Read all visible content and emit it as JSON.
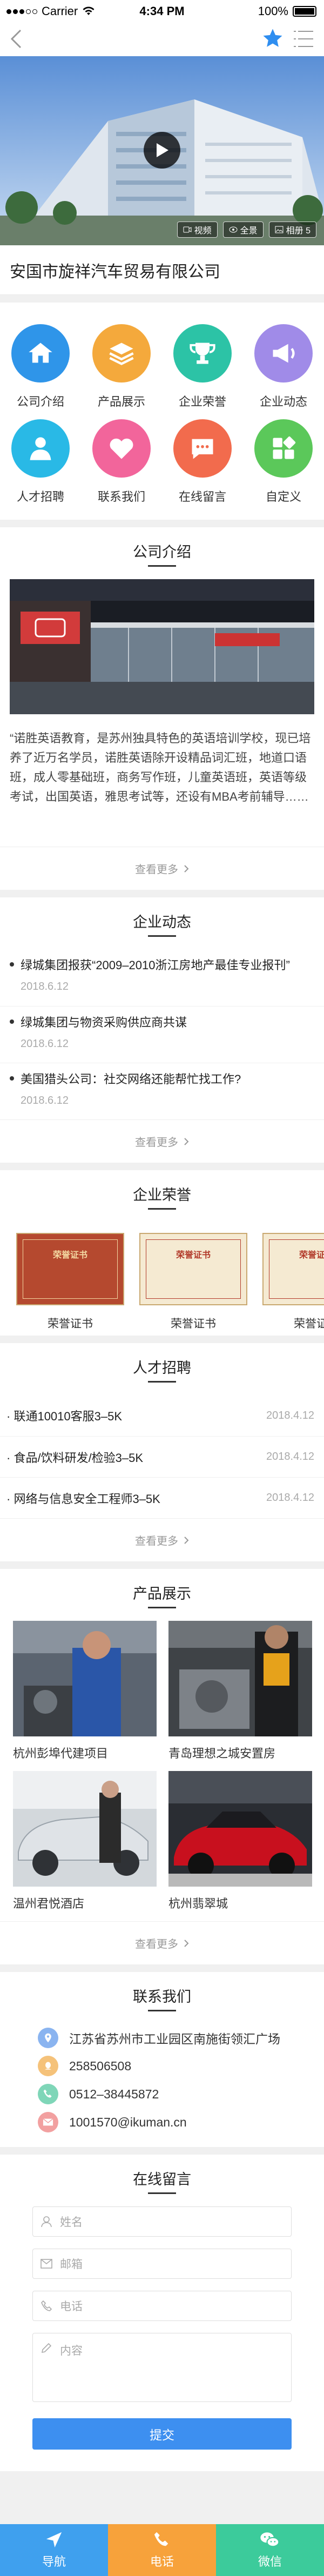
{
  "status": {
    "carrier": "Carrier",
    "time": "4:34 PM",
    "battery": "100%"
  },
  "hero": {
    "tags": [
      "视频",
      "全景",
      "相册 5"
    ]
  },
  "company": {
    "name": "安国市旋祥汽车贸易有限公司"
  },
  "grid": [
    {
      "label": "公司介绍",
      "icon": "home-icon",
      "color": "#2f95e9"
    },
    {
      "label": "产品展示",
      "icon": "layers-icon",
      "color": "#f4a93c"
    },
    {
      "label": "企业荣誉",
      "icon": "trophy-icon",
      "color": "#2cc3a6"
    },
    {
      "label": "企业动态",
      "icon": "megaphone-icon",
      "color": "#a08be8"
    },
    {
      "label": "人才招聘",
      "icon": "person-icon",
      "color": "#29b9e6"
    },
    {
      "label": "联系我们",
      "icon": "heart-icon",
      "color": "#f2659b"
    },
    {
      "label": "在线留言",
      "icon": "chat-icon",
      "color": "#f26b4d"
    },
    {
      "label": "自定义",
      "icon": "apps-icon",
      "color": "#5bc85a"
    }
  ],
  "intro": {
    "title": "公司介绍",
    "text": "“诺胜英语教育，是苏州独具特色的英语培训学校，现已培养了近万名学员，诺胜英语除开设精品词汇班，地道口语班，成人零基础班，商务写作班，儿童英语班，英语等级考试，出国英语，雅思考试等，还设有MBA考前辅导……",
    "more": "查看更多"
  },
  "news": {
    "title": "企业动态",
    "more": "查看更多",
    "items": [
      {
        "title": "绿城集团报获“2009–2010浙江房地产最佳专业报刊”",
        "date": "2018.6.12"
      },
      {
        "title": "绿城集团与物资采购供应商共谋",
        "date": "2018.6.12"
      },
      {
        "title": "美国猎头公司：社交网络还能帮忙找工作?",
        "date": "2018.6.12"
      }
    ]
  },
  "honors": {
    "title": "企业荣誉",
    "items": [
      {
        "label": "荣誉证书",
        "cert": "荣誉证书"
      },
      {
        "label": "荣誉证书",
        "cert": "荣誉证书"
      },
      {
        "label": "荣誉证书",
        "cert": "荣誉证书"
      }
    ]
  },
  "jobs": {
    "title": "人才招聘",
    "more": "查看更多",
    "items": [
      {
        "title": "联通10010客服3–5K",
        "date": "2018.4.12"
      },
      {
        "title": "食品/饮料研发/检验3–5K",
        "date": "2018.4.12"
      },
      {
        "title": "网络与信息安全工程师3–5K",
        "date": "2018.4.12"
      }
    ]
  },
  "products": {
    "title": "产品展示",
    "more": "查看更多",
    "items": [
      {
        "label": "杭州彭埠代建项目"
      },
      {
        "label": "青岛理想之城安置房"
      },
      {
        "label": "温州君悦酒店"
      },
      {
        "label": "杭州翡翠城"
      }
    ]
  },
  "contact": {
    "title": "联系我们",
    "items": [
      {
        "text": "江苏省苏州市工业园区南施街领汇广场",
        "icon": "location-icon",
        "color": "#8ab4f0"
      },
      {
        "text": "258506508",
        "icon": "qq-icon",
        "color": "#f5c27a"
      },
      {
        "text": "0512–38445872",
        "icon": "phone-icon",
        "color": "#7fd6b8"
      },
      {
        "text": "1001570@ikuman.cn",
        "icon": "mail-icon",
        "color": "#f2a0a0"
      }
    ]
  },
  "message": {
    "title": "在线留言",
    "name_ph": "姓名",
    "email_ph": "邮箱",
    "phone_ph": "电话",
    "content_ph": "内容",
    "submit": "提交"
  },
  "tabbar": [
    {
      "label": "导航",
      "color": "#3fa0ee"
    },
    {
      "label": "电话",
      "color": "#f7a23b"
    },
    {
      "label": "微信",
      "color": "#3ccb9b"
    }
  ]
}
